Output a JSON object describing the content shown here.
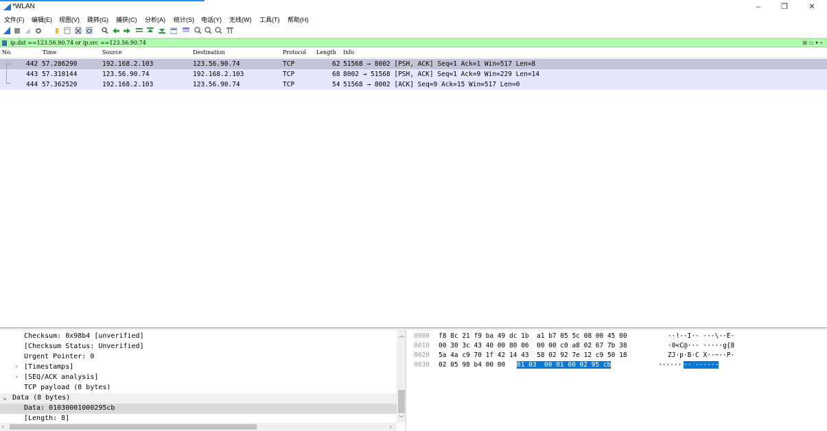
{
  "window": {
    "title": "*WLAN",
    "minimize": "–",
    "maximize": "❐",
    "close": "✕"
  },
  "menu": [
    "文件(F)",
    "编辑(E)",
    "视图(V)",
    "跳转(G)",
    "捕获(C)",
    "分析(A)",
    "统计(S)",
    "电话(Y)",
    "无线(W)",
    "工具(T)",
    "帮助(H)"
  ],
  "filter": {
    "value": "ip.dst ==123.56.90.74 or ip.src ==123.56.90.74",
    "right_controls": "⊠ ▭ ▾ +"
  },
  "columns": {
    "no": "No.",
    "time": "Time",
    "source": "Source",
    "destination": "Destination",
    "protocol": "Protocol",
    "length": "Length",
    "info": "Info"
  },
  "packets": [
    {
      "no": "442",
      "time": "57.286290",
      "source": "192.168.2.103",
      "destination": "123.56.90.74",
      "protocol": "TCP",
      "length": "62",
      "info": "51568 → 8002 [PSH, ACK] Seq=1 Ack=1 Win=517 Len=8"
    },
    {
      "no": "443",
      "time": "57.310144",
      "source": "123.56.90.74",
      "destination": "192.168.2.103",
      "protocol": "TCP",
      "length": "68",
      "info": "8002 → 51568 [PSH, ACK] Seq=1 Ack=9 Win=229 Len=14"
    },
    {
      "no": "444",
      "time": "57.362520",
      "source": "192.168.2.103",
      "destination": "123.56.90.74",
      "protocol": "TCP",
      "length": "54",
      "info": "51568 → 8002 [ACK] Seq=9 Ack=15 Win=517 Len=0"
    }
  ],
  "details": [
    {
      "text": "Checksum: 0x98b4 [unverified]",
      "arrow": ""
    },
    {
      "text": "[Checksum Status: Unverified]",
      "arrow": ""
    },
    {
      "text": "Urgent Pointer: 0",
      "arrow": ""
    },
    {
      "text": "[Timestamps]",
      "arrow": "›"
    },
    {
      "text": "[SEQ/ACK analysis]",
      "arrow": "›"
    },
    {
      "text": "TCP payload (8 bytes)",
      "arrow": ""
    },
    {
      "text": "Data (8 bytes)",
      "arrow": "⌄"
    },
    {
      "text": "Data: 01030001000295cb",
      "arrow": ""
    },
    {
      "text": "[Length: 8]",
      "arrow": ""
    }
  ],
  "hex": [
    {
      "offset": "0000",
      "hex": "f8 8c 21 f9 ba 49 dc 1b  a1 b7 05 5c 08 00 45 00",
      "hex_hl": "",
      "ascii": "··!··I·· ···\\··E·",
      "ascii_hl": ""
    },
    {
      "offset": "0010",
      "hex": "00 30 3c 43 40 00 80 06  00 00 c0 a8 02 67 7b 38",
      "hex_hl": "",
      "ascii": "·0<C@··· ·····g{8",
      "ascii_hl": ""
    },
    {
      "offset": "0020",
      "hex": "5a 4a c9 70 1f 42 14 43  58 02 92 7e 12 c9 50 18",
      "hex_hl": "",
      "ascii": "ZJ·p·B·C X··~··P·",
      "ascii_hl": ""
    },
    {
      "offset": "0030",
      "hex": "02 05 98 b4 00 00 ",
      "hex_hl": "01 03  00 01 00 02 95 cb",
      "ascii": "······",
      "ascii_hl": "·· ······"
    }
  ]
}
